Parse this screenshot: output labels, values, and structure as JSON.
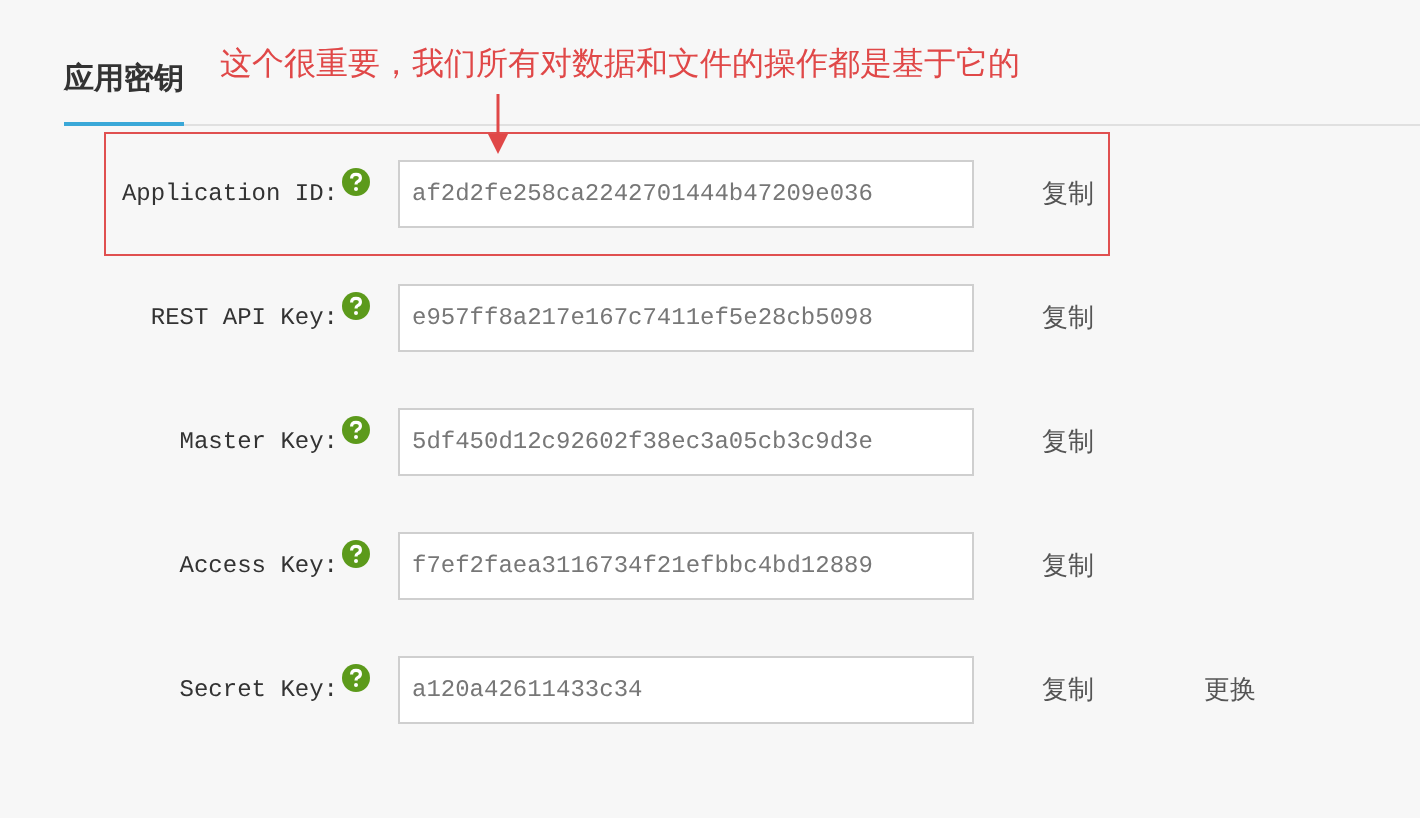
{
  "tabs": [
    {
      "label": "应用密钥",
      "selected": true
    }
  ],
  "annotation": {
    "text": "这个很重要，我们所有对数据和文件的操作都是基于它的"
  },
  "keys": [
    {
      "label": "Application ID:",
      "value": "af2d2fe258ca2242701444b47209e036",
      "highlighted": true,
      "actions": [
        "复制"
      ]
    },
    {
      "label": "REST API Key:",
      "value": "e957ff8a217e167c7411ef5e28cb5098",
      "highlighted": false,
      "actions": [
        "复制"
      ]
    },
    {
      "label": "Master Key:",
      "value": "5df450d12c92602f38ec3a05cb3c9d3e",
      "highlighted": false,
      "actions": [
        "复制"
      ]
    },
    {
      "label": "Access Key:",
      "value": "f7ef2faea3116734f21efbbc4bd12889",
      "highlighted": false,
      "actions": [
        "复制"
      ]
    },
    {
      "label": "Secret Key:",
      "value": "a120a42611433c34",
      "highlighted": false,
      "actions": [
        "复制",
        "更换"
      ]
    }
  ]
}
